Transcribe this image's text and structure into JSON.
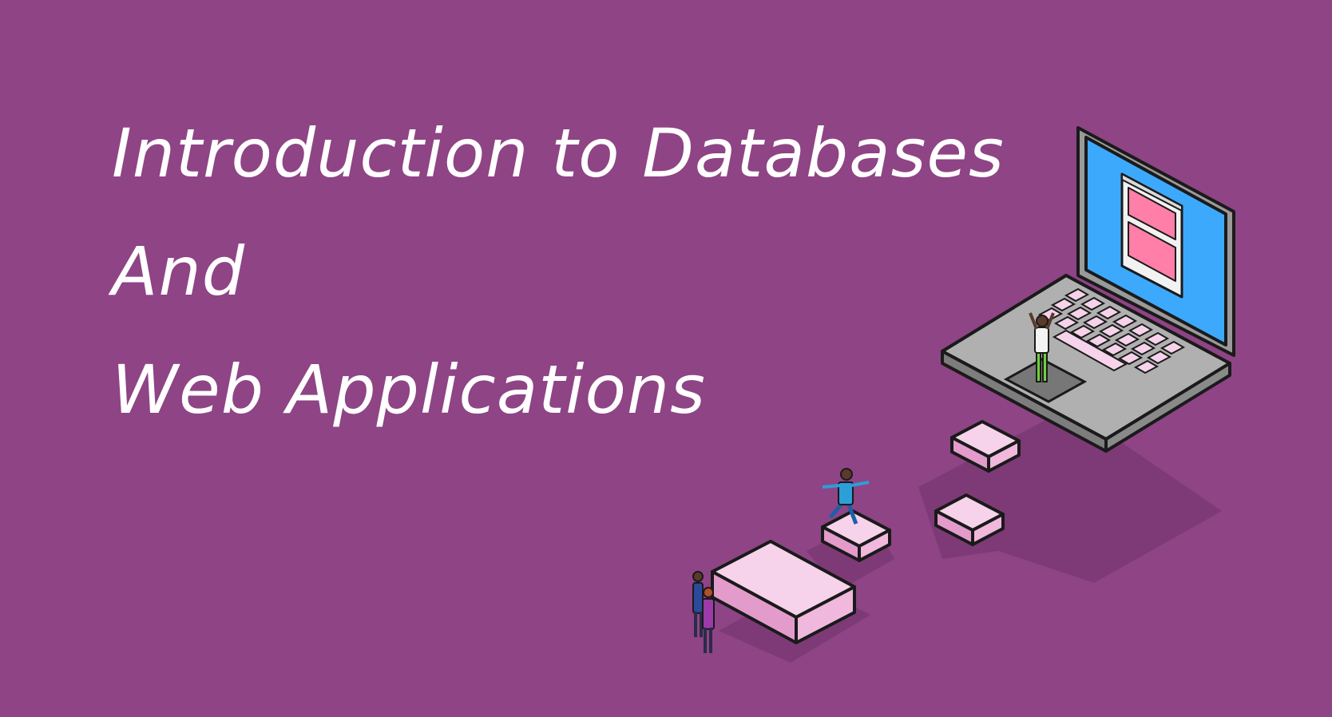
{
  "banner": {
    "title_lines": [
      "Introduction to Databases",
      "And",
      "Web Applications"
    ]
  },
  "colors": {
    "background": "#8e4485",
    "title_text": "#ffffff",
    "shadow": "#7e3a76",
    "key_top": "#f6d3ea",
    "key_side": "#e39bcc",
    "outline": "#1a1a1a",
    "laptop_body": "#a3a3a3",
    "laptop_top": "#b5b5b5",
    "screen_blue": "#3da9fc",
    "screen_window": "#ff7fa8",
    "person_shirt_blue": "#2c9ed8",
    "person_pants_green": "#6fd13a"
  },
  "illustration": {
    "icon": "laptop-with-keys-and-people-illustration"
  }
}
